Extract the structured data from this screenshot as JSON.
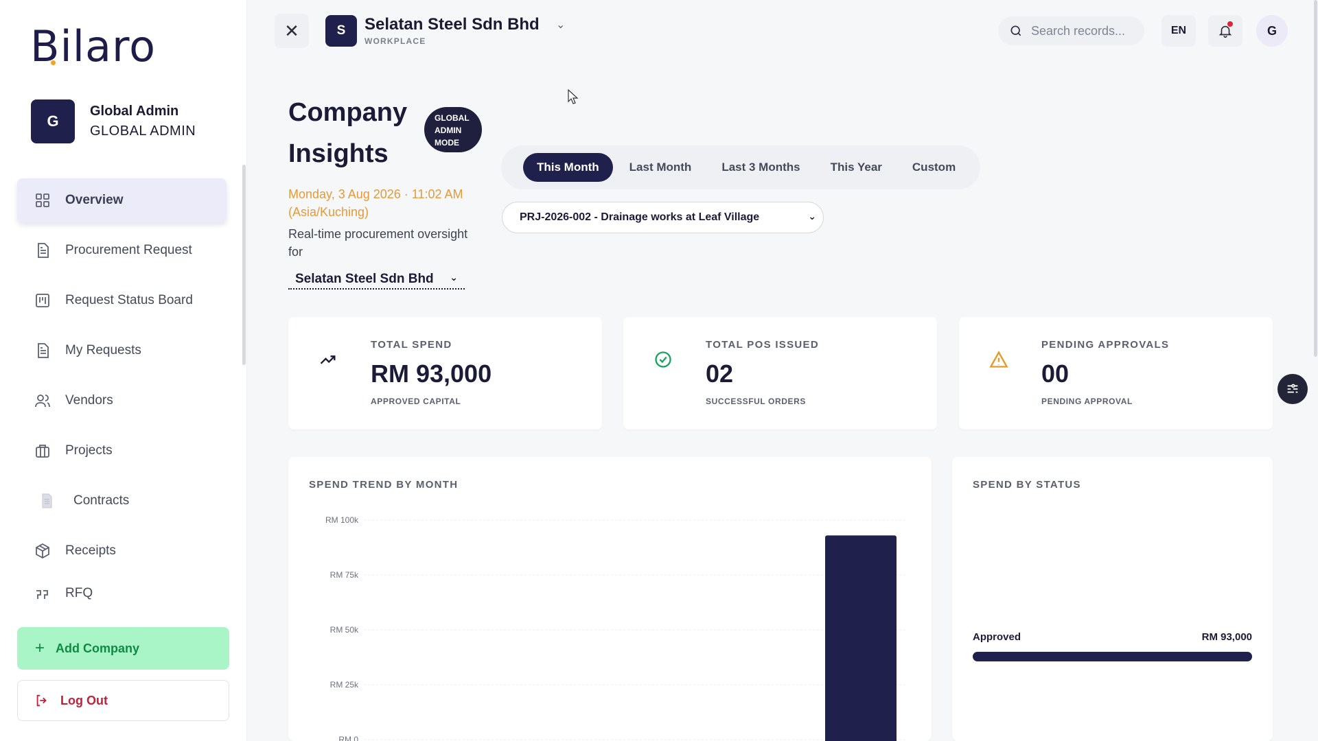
{
  "brand": {
    "logo_text": "Bilaro"
  },
  "profile": {
    "initial": "G",
    "name": "Global Admin",
    "role": "GLOBAL ADMIN"
  },
  "sidebar": {
    "items": [
      {
        "label": "Overview",
        "icon": "grid-icon",
        "active": true
      },
      {
        "label": "Procurement Request",
        "icon": "document-icon"
      },
      {
        "label": "Request Status Board",
        "icon": "kanban-icon"
      },
      {
        "label": "My Requests",
        "icon": "document-icon"
      },
      {
        "label": "Vendors",
        "icon": "users-icon"
      },
      {
        "label": "Projects",
        "icon": "briefcase-icon"
      },
      {
        "label": "Contracts",
        "icon": "file-icon"
      },
      {
        "label": "Receipts",
        "icon": "package-icon"
      },
      {
        "label": "RFQ",
        "icon": "quote-icon"
      }
    ],
    "add_company": "Add Company",
    "logout": "Log Out"
  },
  "topbar": {
    "workspace_initial": "S",
    "workspace_name": "Selatan Steel Sdn Bhd",
    "workspace_type": "WORKPLACE",
    "search_placeholder": "Search records...",
    "language": "EN",
    "user_initial": "G"
  },
  "header": {
    "title": "Company Insights",
    "mode_badge": [
      "GLOBAL",
      "ADMIN",
      "MODE"
    ],
    "date_line": "Monday, 3 Aug 2026 · 11:02 AM (Asia/Kuching)",
    "description": "Real-time procurement oversight for",
    "company_select": "Selatan Steel Sdn Bhd"
  },
  "periods": [
    "This Month",
    "Last Month",
    "Last 3 Months",
    "This Year",
    "Custom"
  ],
  "active_period": "This Month",
  "project_select": "PRJ-2026-002 - Drainage works at Leaf Village",
  "stats": [
    {
      "label": "TOTAL SPEND",
      "value": "RM 93,000",
      "sub": "APPROVED CAPITAL",
      "icon": "trend-up-icon",
      "color": "#1b1b38"
    },
    {
      "label": "TOTAL POS ISSUED",
      "value": "02",
      "sub": "SUCCESSFUL ORDERS",
      "icon": "check-circle-icon",
      "color": "#1aa35c"
    },
    {
      "label": "PENDING APPROVALS",
      "value": "00",
      "sub": "PENDING APPROVAL",
      "icon": "warning-icon",
      "color": "#e69a23"
    }
  ],
  "spend_trend": {
    "title": "SPEND TREND BY MONTH"
  },
  "chart_data": {
    "type": "bar",
    "title": "SPEND TREND BY MONTH",
    "y_tick_labels": [
      "RM 100k",
      "RM 75k",
      "RM 50k",
      "RM 25k",
      "RM 0"
    ],
    "ylim": [
      0,
      100000
    ],
    "series": [
      {
        "values": [
          93000
        ],
        "color": "#20204d"
      }
    ],
    "grid": true
  },
  "spend_by_status": {
    "title": "SPEND BY STATUS",
    "rows": [
      {
        "label": "Approved",
        "value": "RM 93,000",
        "fraction": 1.0
      }
    ]
  },
  "colors": {
    "primary": "#20204d",
    "accent": "#f0a325",
    "success": "#1aa35c",
    "danger": "#c0213b"
  }
}
